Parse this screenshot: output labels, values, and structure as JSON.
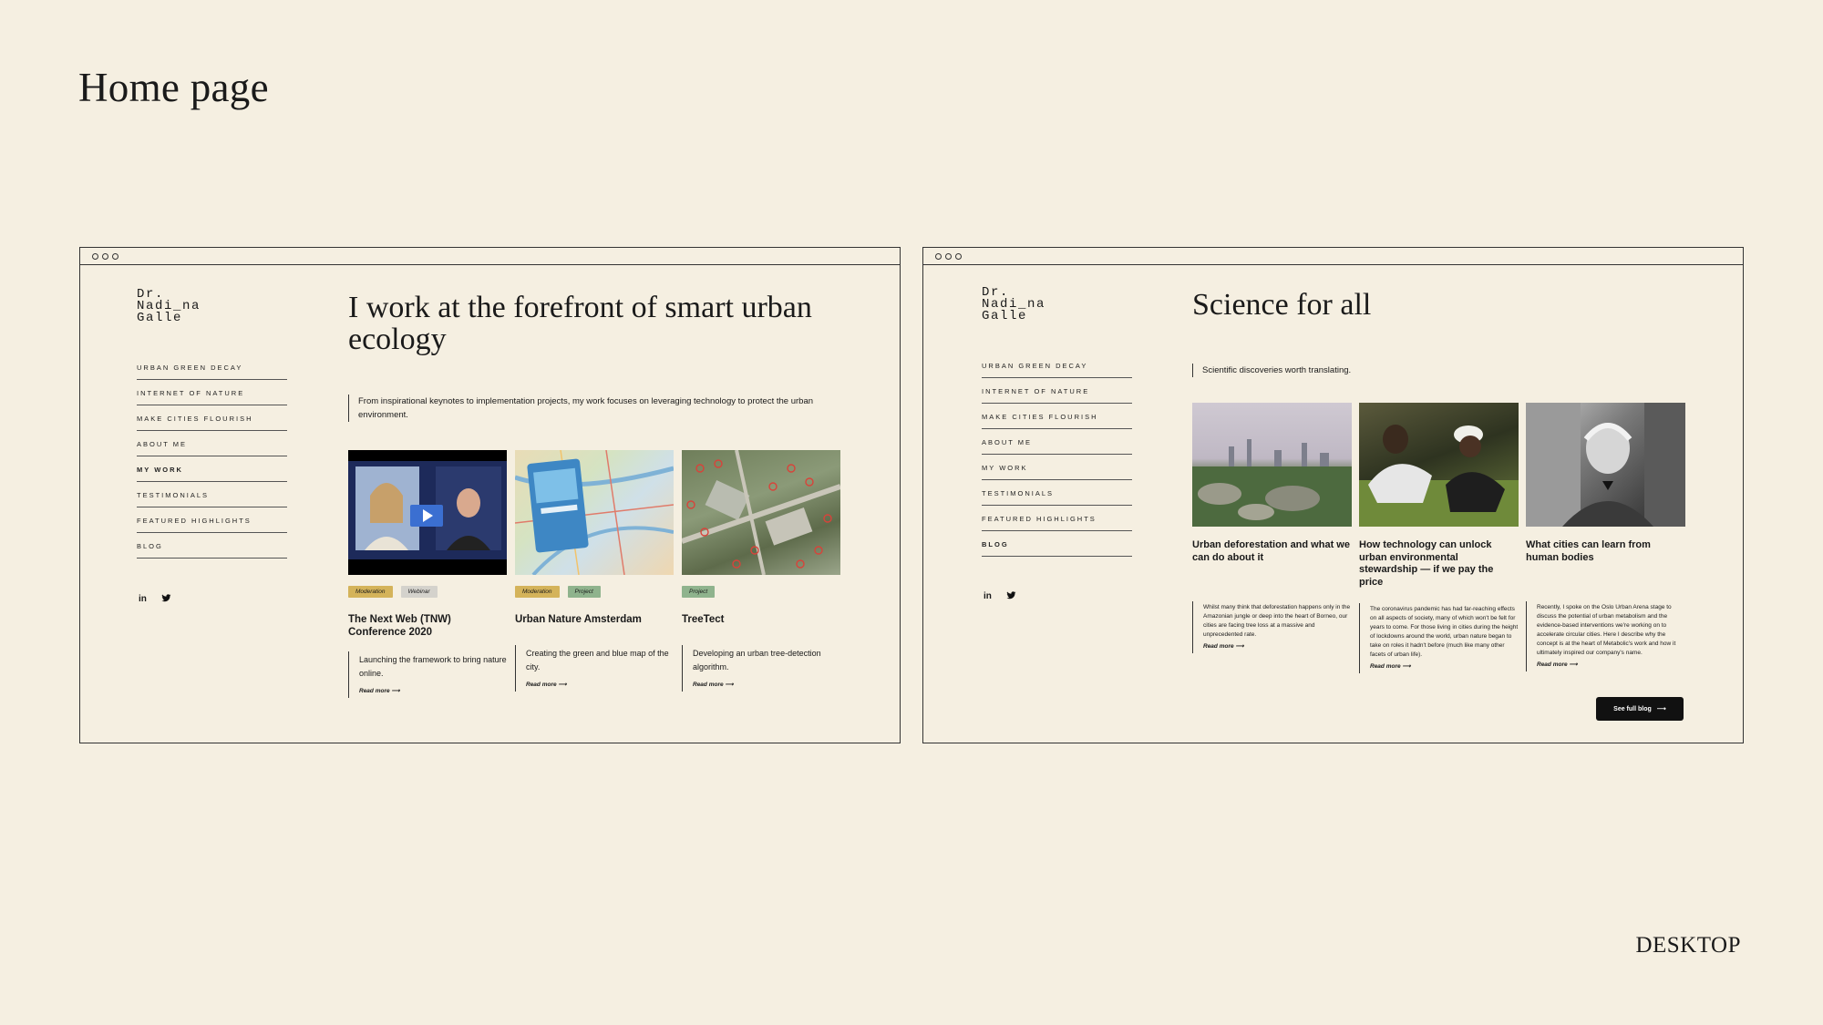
{
  "page": {
    "title": "Home page",
    "device_label": "DESKTOP"
  },
  "frame1": {
    "logo": "Dr.\nNadi_na\nGalle",
    "nav": [
      "URBAN GREEN DECAY",
      "INTERNET OF NATURE",
      "MAKE CITIES FLOURISH",
      "ABOUT ME",
      "MY WORK",
      "TESTIMONIALS",
      "FEATURED HIGHLIGHTS",
      "BLOG"
    ],
    "active_nav": "MY WORK",
    "social": {
      "linkedin": "in",
      "twitter": "twitter-icon"
    },
    "hero": "I work at the forefront of smart urban ecology",
    "intro": "From inspirational keynotes to implementation projects, my work focuses on leveraging technology to protect the urban environment.",
    "cards": [
      {
        "tags": [
          "Moderation",
          "Webinar"
        ],
        "title": "The Next Web (TNW) Conference 2020",
        "desc": "Launching the framework to bring nature online.",
        "read_more": "Read more"
      },
      {
        "tags": [
          "Moderation",
          "Project"
        ],
        "title": "Urban Nature Amsterdam",
        "desc": "Creating the green and blue map of the city.",
        "read_more": "Read more"
      },
      {
        "tags": [
          "Project"
        ],
        "title": "TreeTect",
        "desc": "Developing an urban tree-detection algorithm.",
        "read_more": "Read more"
      }
    ]
  },
  "frame2": {
    "logo": "Dr.\nNadi_na\nGalle",
    "nav": [
      "URBAN GREEN DECAY",
      "INTERNET OF NATURE",
      "MAKE CITIES FLOURISH",
      "ABOUT ME",
      "MY WORK",
      "TESTIMONIALS",
      "FEATURED HIGHLIGHTS",
      "BLOG"
    ],
    "active_nav": "BLOG",
    "hero": "Science for all",
    "intro": "Scientific discoveries worth translating.",
    "posts": [
      {
        "title": "Urban deforestation and what we can do about it",
        "desc": "Whilst many think that deforestation happens only in the Amazonian jungle or deep into the heart of Borneo, our cities are facing tree loss at a massive and unprecedented rate.",
        "read_more": "Read more"
      },
      {
        "title": "How technology can unlock urban environmental stewardship — if we pay the price",
        "desc": "The coronavirus pandemic has had far-reaching effects on all aspects of society, many of which won't be felt for years to come. For those living in cities during the height of lockdowns around the world, urban nature began to take on roles it hadn't before (much like many other facets of urban life).",
        "read_more": "Read more"
      },
      {
        "title": "What cities can learn from human bodies",
        "desc": "Recently, I spoke on the Oslo Urban Arena stage to discuss the potential of urban metabolism and the evidence-based interventions we're working on to accelerate circular cities. Here I describe why the concept is at the heart of Metabolic's work and how it ultimately inspired our company's name.",
        "read_more": "Read more"
      }
    ],
    "see_blog": "See full blog"
  }
}
